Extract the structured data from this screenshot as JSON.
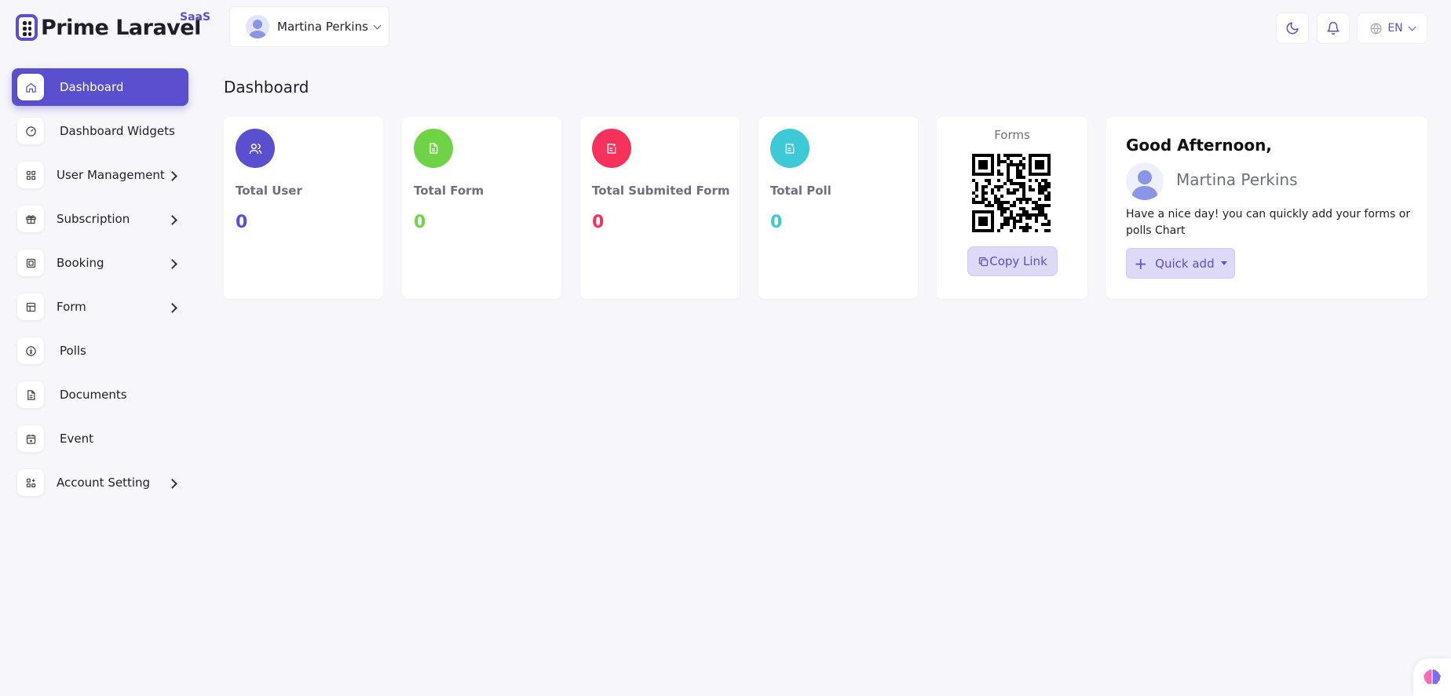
{
  "brand": {
    "name": "Prime Laravel",
    "badge": "SaaS",
    "accent": "#5a4fcf"
  },
  "header": {
    "user_name": "Martina Perkins",
    "language": "EN",
    "icons": [
      "moon-icon",
      "bell-icon",
      "globe-icon"
    ]
  },
  "sidebar": {
    "items": [
      {
        "label": "Dashboard",
        "icon": "home-icon",
        "active": true,
        "has_submenu": false
      },
      {
        "label": "Dashboard Widgets",
        "icon": "gauge-icon",
        "has_submenu": false
      },
      {
        "label": "User Management",
        "icon": "apps-icon",
        "has_submenu": true
      },
      {
        "label": "Subscription",
        "icon": "gift-icon",
        "has_submenu": true
      },
      {
        "label": "Booking",
        "icon": "frame-icon",
        "has_submenu": true
      },
      {
        "label": "Form",
        "icon": "table-icon",
        "has_submenu": true
      },
      {
        "label": "Polls",
        "icon": "poll-icon",
        "has_submenu": false
      },
      {
        "label": "Documents",
        "icon": "document-icon",
        "has_submenu": false
      },
      {
        "label": "Event",
        "icon": "calendar-icon",
        "has_submenu": false
      },
      {
        "label": "Account Setting",
        "icon": "settings-grid-icon",
        "has_submenu": true
      }
    ]
  },
  "main": {
    "title": "Dashboard",
    "stats": [
      {
        "label": "Total User",
        "value": "0",
        "color": "#5a4fcf",
        "icon": "users-icon"
      },
      {
        "label": "Total Form",
        "value": "0",
        "color": "#6fd445",
        "icon": "file-icon"
      },
      {
        "label": "Total Submited Form",
        "value": "0",
        "color": "#f5325c",
        "icon": "file-check-icon"
      },
      {
        "label": "Total Poll",
        "value": "0",
        "color": "#3ec9d6",
        "icon": "poll-doc-icon"
      }
    ],
    "forms_card": {
      "title": "Forms",
      "copy_label": "Copy Link"
    },
    "greeting": {
      "title": "Good Afternoon,",
      "name": "Martina Perkins",
      "message": "Have a nice day! you can quickly add your forms or polls Chart",
      "quick_add_label": "Quick add"
    }
  }
}
